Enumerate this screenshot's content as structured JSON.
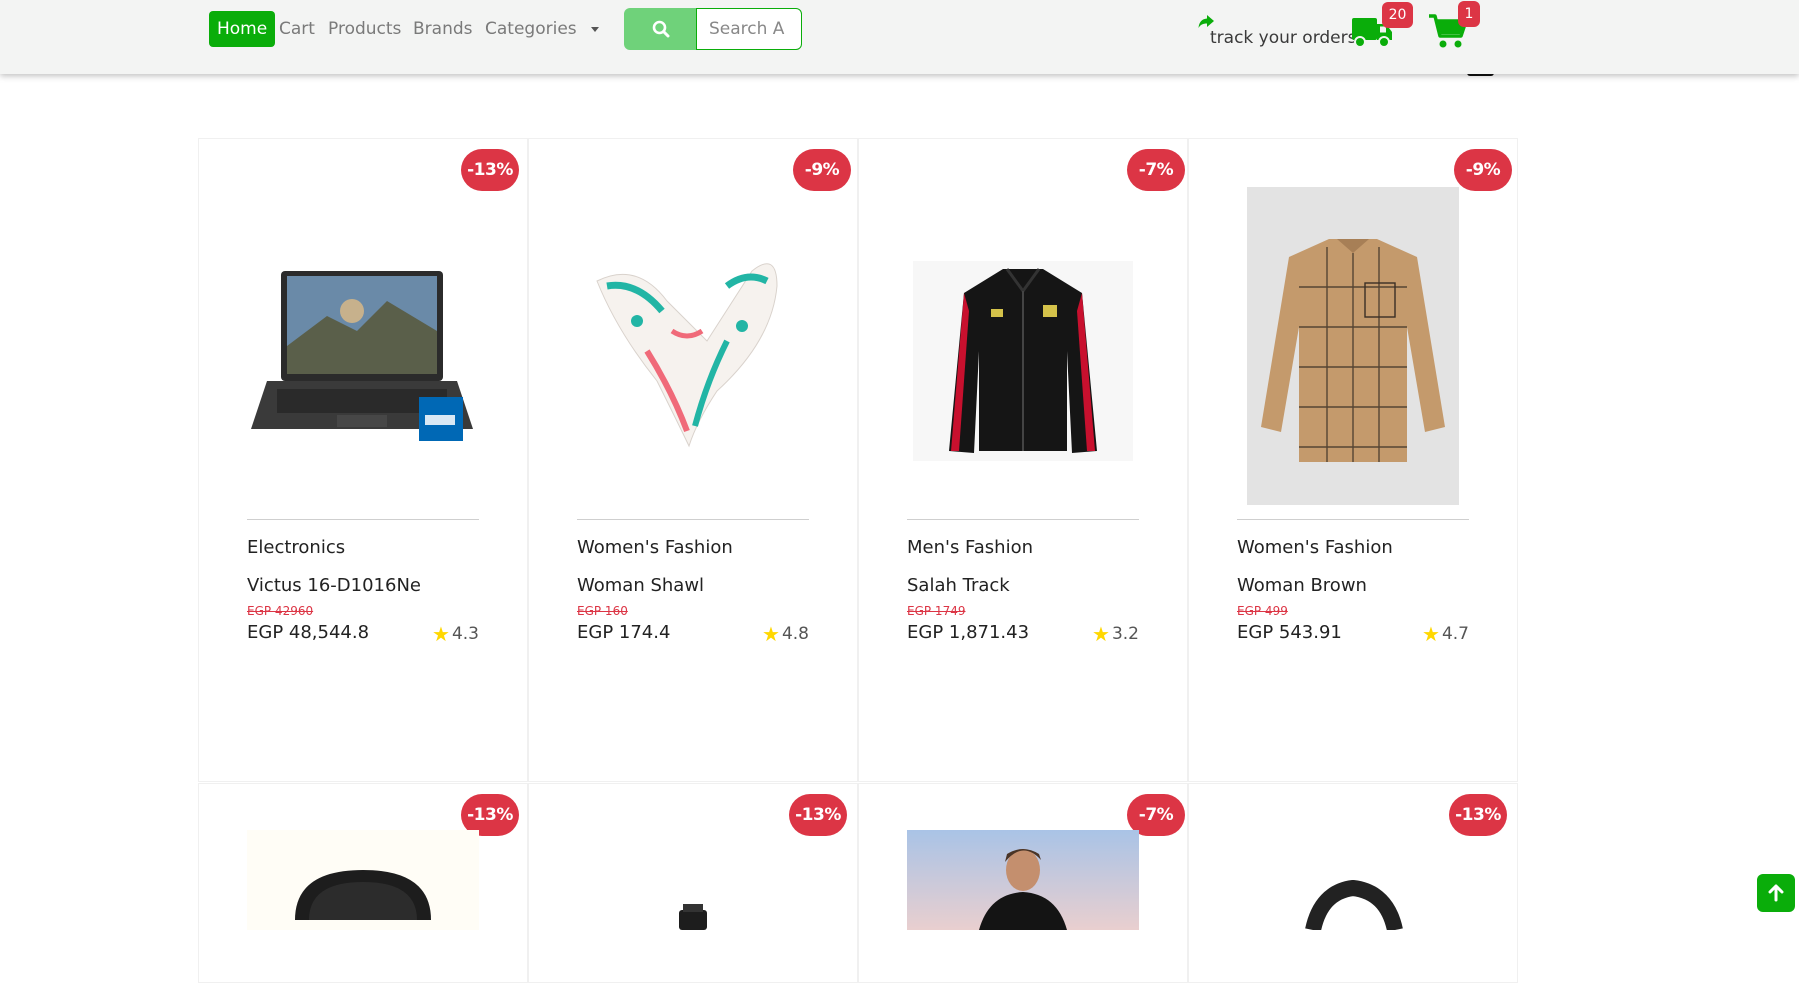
{
  "nav": {
    "links": [
      "Home",
      "Cart",
      "Products",
      "Brands",
      "Categories"
    ],
    "search_placeholder": "Search A",
    "track_label": "track your orders",
    "truck_badge": "20",
    "cart_badge": "1",
    "accent_color": "#0aad0a",
    "badge_color": "#dc3545"
  },
  "products": [
    {
      "discount": "-13%",
      "category": "Electronics",
      "title": "Victus 16-D1016Ne",
      "old_price": "EGP 42960",
      "price": "EGP 48,544.8",
      "rating": "4.3",
      "image": "laptop-image"
    },
    {
      "discount": "-9%",
      "category": "Women's Fashion",
      "title": "Woman Shawl",
      "old_price": "EGP 160",
      "price": "EGP 174.4",
      "rating": "4.8",
      "image": "shawl-image"
    },
    {
      "discount": "-7%",
      "category": "Men's Fashion",
      "title": "Salah Track",
      "old_price": "EGP 1749",
      "price": "EGP 1,871.43",
      "rating": "3.2",
      "image": "jacket-image"
    },
    {
      "discount": "-9%",
      "category": "Women's Fashion",
      "title": "Woman Brown",
      "old_price": "EGP 499",
      "price": "EGP 543.91",
      "rating": "4.7",
      "image": "shirt-image"
    }
  ],
  "second_row": [
    {
      "discount": "-13%",
      "image": "earbuds-case-image"
    },
    {
      "discount": "-13%",
      "image": "watch-image"
    },
    {
      "discount": "-7%",
      "image": "man-portrait-image"
    },
    {
      "discount": "-13%",
      "image": "smart-band-image"
    }
  ],
  "icons": {
    "search": "search-icon",
    "share": "share-arrow-icon",
    "truck": "truck-icon",
    "cart": "cart-icon",
    "star": "star-icon",
    "scroll_top": "arrow-up-icon"
  }
}
